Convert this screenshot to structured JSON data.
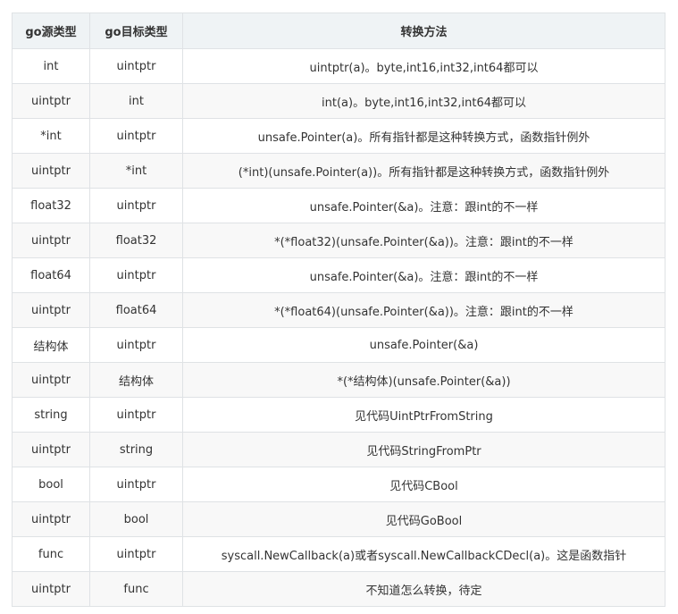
{
  "table": {
    "headers": [
      "go源类型",
      "go目标类型",
      "转换方法"
    ],
    "rows": [
      [
        "int",
        "uintptr",
        "uintptr(a)。byte,int16,int32,int64都可以"
      ],
      [
        "uintptr",
        "int",
        "int(a)。byte,int16,int32,int64都可以"
      ],
      [
        "*int",
        "uintptr",
        "unsafe.Pointer(a)。所有指针都是这种转换方式，函数指针例外"
      ],
      [
        "uintptr",
        "*int",
        "(*int)(unsafe.Pointer(a))。所有指针都是这种转换方式，函数指针例外"
      ],
      [
        "float32",
        "uintptr",
        "unsafe.Pointer(&a)。注意：跟int的不一样"
      ],
      [
        "uintptr",
        "float32",
        "*(*float32)(unsafe.Pointer(&a))。注意：跟int的不一样"
      ],
      [
        "float64",
        "uintptr",
        "unsafe.Pointer(&a)。注意：跟int的不一样"
      ],
      [
        "uintptr",
        "float64",
        "*(*float64)(unsafe.Pointer(&a))。注意：跟int的不一样"
      ],
      [
        "结构体",
        "uintptr",
        "unsafe.Pointer(&a)"
      ],
      [
        "uintptr",
        "结构体",
        "*(*结构体)(unsafe.Pointer(&a))"
      ],
      [
        "string",
        "uintptr",
        "见代码UintPtrFromString"
      ],
      [
        "uintptr",
        "string",
        "见代码StringFromPtr"
      ],
      [
        "bool",
        "uintptr",
        "见代码CBool"
      ],
      [
        "uintptr",
        "bool",
        "见代码GoBool"
      ],
      [
        "func",
        "uintptr",
        "syscall.NewCallback(a)或者syscall.NewCallbackCDecl(a)。这是函数指针"
      ],
      [
        "uintptr",
        "func",
        "不知道怎么转换，待定"
      ]
    ]
  },
  "colors": {
    "header_bg": "#eff3f5",
    "stripe_bg": "#f8f8f8",
    "border": "#dfe2e5",
    "text": "#333333"
  }
}
